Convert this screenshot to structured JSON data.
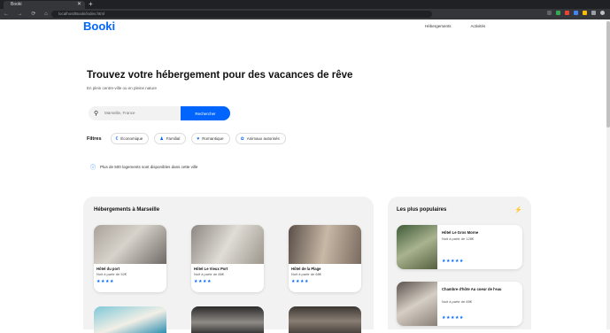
{
  "browser": {
    "tab_title": "Booki",
    "tab_close": "✕",
    "new_tab": "+",
    "nav_icons": "← → ⟳ ⌂",
    "url": "localhost/Booki/index.html"
  },
  "header": {
    "logo": "Booki",
    "nav": [
      "Hébergements",
      "Activités"
    ]
  },
  "hero": {
    "title": "Trouvez votre hébergement pour des vacances de rêve",
    "subtitle": "En plein centre-ville ou en pleine nature",
    "search_placeholder": "Marseille, France",
    "search_button": "Rechercher"
  },
  "filters": {
    "label": "Filtres",
    "items": [
      {
        "icon": "money-icon",
        "glyph": "€",
        "label": "Économique"
      },
      {
        "icon": "family-icon",
        "glyph": "♟",
        "label": "Familial"
      },
      {
        "icon": "heart-icon",
        "glyph": "♥",
        "label": "Romantique"
      },
      {
        "icon": "pet-icon",
        "glyph": "✿",
        "label": "Animaux autorisés"
      }
    ]
  },
  "info": {
    "glyph": "ⓘ",
    "text": "Plus de 500 logements sont disponibles dans cette ville"
  },
  "lodging": {
    "title": "Hébergements à Marseille",
    "cards": [
      {
        "name": "Hôtel du port",
        "price": "Nuit à partir de 52€",
        "stars": "★★★★"
      },
      {
        "name": "Hôtel Le Vieux Port",
        "price": "Nuit à partir de 86€",
        "stars": "★★★★"
      },
      {
        "name": "Hôtel de la Plage",
        "price": "Nuit à partir de 68€",
        "stars": "★★★★"
      }
    ]
  },
  "popular": {
    "title": "Les plus populaires",
    "icon": "⚡",
    "cards": [
      {
        "name": "Hôtel Le Gros Morne",
        "price": "Nuit à partir de 128€",
        "stars": "★★★★★"
      },
      {
        "name": "Chambre d'hôte Au coeur de l'eau",
        "price": "Nuit à partir de 89€",
        "stars": "★★★★★"
      }
    ]
  },
  "colors": {
    "accent": "#0065fc",
    "section_bg": "#f2f2f2"
  }
}
